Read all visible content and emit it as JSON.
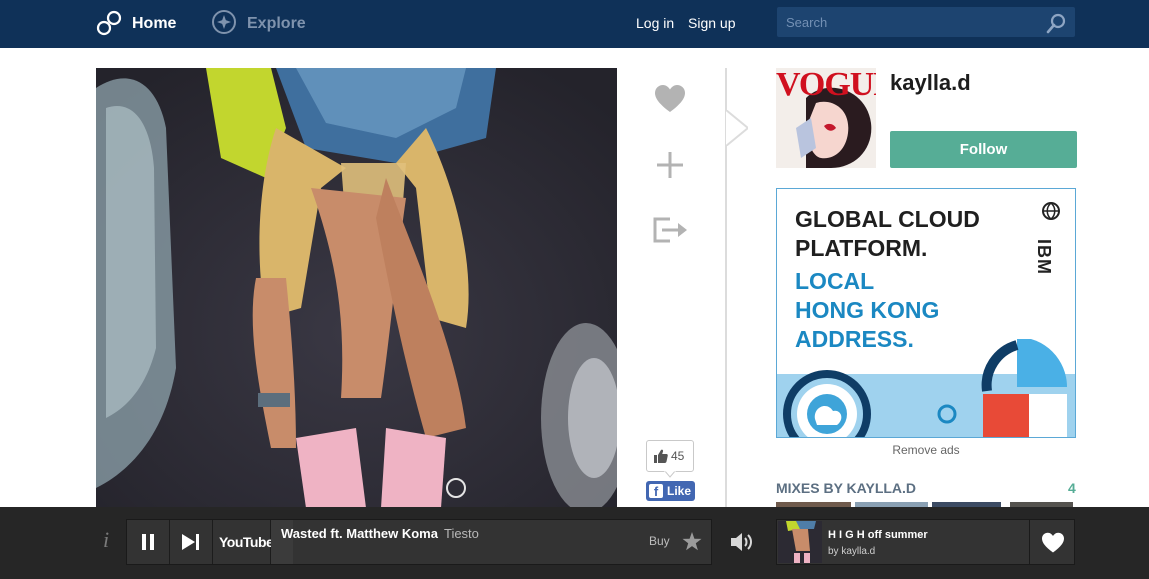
{
  "nav": {
    "home_label": "Home",
    "explore_label": "Explore",
    "login_label": "Log in",
    "signup_label": "Sign up",
    "search_placeholder": "Search"
  },
  "actions": {
    "like_count": "45",
    "fb_like_label": "Like"
  },
  "profile": {
    "username": "kaylla.d",
    "follow_label": "Follow",
    "avatar_text": "VOGUE"
  },
  "ad": {
    "line1": "GLOBAL CLOUD",
    "line2": "PLATFORM.",
    "line3": "LOCAL",
    "line4": "HONG KONG",
    "line5": "ADDRESS.",
    "brand": "IBM",
    "remove_label": "Remove ads"
  },
  "mixes": {
    "title": "MIXES BY KAYLLA.D",
    "count": "4"
  },
  "player": {
    "info_label": "i",
    "youtube_label": "YouTube",
    "track_title": "Wasted ft. Matthew Koma",
    "track_artist": "Tiesto",
    "buy_label": "Buy",
    "progress": 0.05,
    "mix_title": "H I G H off summer",
    "mix_by": "by kaylla.d"
  },
  "colors": {
    "nav_bg": "#0f3158",
    "accent_green": "#56ad96",
    "ad_blue": "#1b88c2",
    "player_bg": "#262626"
  }
}
